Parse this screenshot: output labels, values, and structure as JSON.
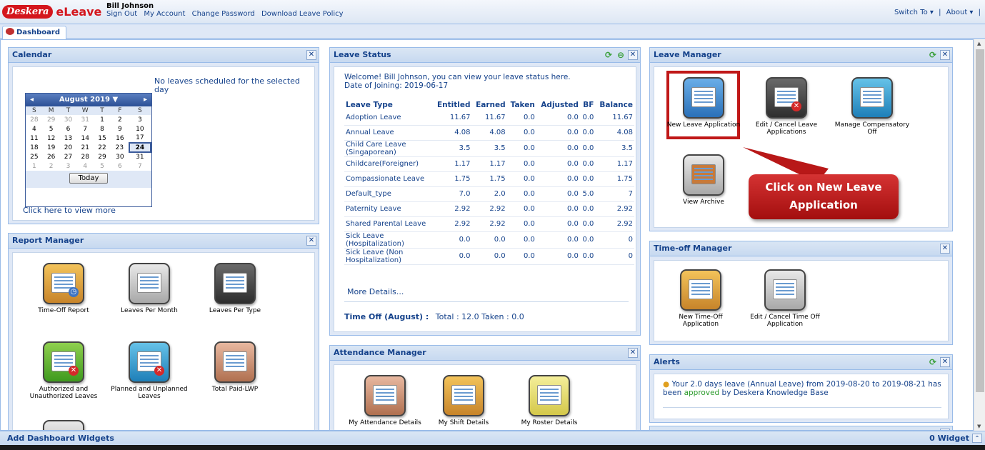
{
  "app": {
    "logo_desk": "Deskera",
    "logo_eleave": "eLeave",
    "user_name": "Bill Johnson",
    "links": [
      "Sign Out",
      "My Account",
      "Change Password",
      "Download Leave Policy"
    ],
    "switch_to": "Switch To ▾",
    "separator": "|",
    "about": "About ▾",
    "separator2": "|"
  },
  "tab": {
    "label": "Dashboard"
  },
  "calendar": {
    "title": "Calendar",
    "month_label": "August 2019 ▼",
    "weekdays": [
      "S",
      "M",
      "T",
      "W",
      "T",
      "F",
      "S"
    ],
    "today_label": "Today",
    "no_leaves": "No leaves scheduled for the selected day",
    "view_more": "Click here to view more"
  },
  "leave_status": {
    "title": "Leave Status",
    "welcome": "Welcome! Bill Johnson, you can view your leave status here.",
    "doj": "Date of Joining: 2019-06-17",
    "headers": [
      "Leave Type",
      "Entitled",
      "Earned",
      "Taken",
      "Adjusted",
      "BF",
      "Balance"
    ],
    "rows": [
      [
        "Adoption Leave",
        "11.67",
        "11.67",
        "0.0",
        "0.0",
        "0.0",
        "11.67"
      ],
      [
        "Annual Leave",
        "4.08",
        "4.08",
        "0.0",
        "0.0",
        "0.0",
        "4.08"
      ],
      [
        "Child Care Leave (Singaporean)",
        "3.5",
        "3.5",
        "0.0",
        "0.0",
        "0.0",
        "3.5"
      ],
      [
        "Childcare(Foreigner)",
        "1.17",
        "1.17",
        "0.0",
        "0.0",
        "0.0",
        "1.17"
      ],
      [
        "Compassionate Leave",
        "1.75",
        "1.75",
        "0.0",
        "0.0",
        "0.0",
        "1.75"
      ],
      [
        "Default_type",
        "7.0",
        "2.0",
        "0.0",
        "0.0",
        "5.0",
        "7"
      ],
      [
        "Paternity Leave",
        "2.92",
        "2.92",
        "0.0",
        "0.0",
        "0.0",
        "2.92"
      ],
      [
        "Shared Parental Leave",
        "2.92",
        "2.92",
        "0.0",
        "0.0",
        "0.0",
        "2.92"
      ],
      [
        "Sick Leave (Hospitalization)",
        "0.0",
        "0.0",
        "0.0",
        "0.0",
        "0.0",
        "0"
      ],
      [
        "Sick Leave (Non Hospitalization)",
        "0.0",
        "0.0",
        "0.0",
        "0.0",
        "0.0",
        "0"
      ]
    ],
    "more_details": "More Details...",
    "time_off_label": "Time Off (August) :",
    "time_off_values": "Total : 12.0 Taken : 0.0"
  },
  "leave_manager": {
    "title": "Leave Manager",
    "items": [
      "New Leave Application",
      "Edit / Cancel Leave Applications",
      "Manage Compensatory Off",
      "View Archive"
    ],
    "callout": "Click on New Leave Application"
  },
  "report_manager": {
    "title": "Report Manager",
    "items": [
      "Time-Off Report",
      "Leaves Per Month",
      "Leaves Per Type",
      "Authorized and Unauthorized Leaves",
      "Planned and Unplanned Leaves",
      "Total Paid-LWP"
    ]
  },
  "timeoff_manager": {
    "title": "Time-off Manager",
    "items": [
      "New Time-Off Application",
      "Edit / Cancel Time Off Application"
    ]
  },
  "attendance_manager": {
    "title": "Attendance Manager",
    "items": [
      "My Attendance Details",
      "My Shift Details",
      "My Roster Details"
    ]
  },
  "alerts": {
    "title": "Alerts",
    "text_a": "Your 2.0 days leave (Annual Leave) from 2019-08-20 to 2019-08-21 has been ",
    "approved": "approved",
    "text_b": " by Deskera Knowledge Base"
  },
  "bottom": {
    "add_widgets": "Add Dashboard Widgets",
    "widget_count": "0 Widget"
  }
}
